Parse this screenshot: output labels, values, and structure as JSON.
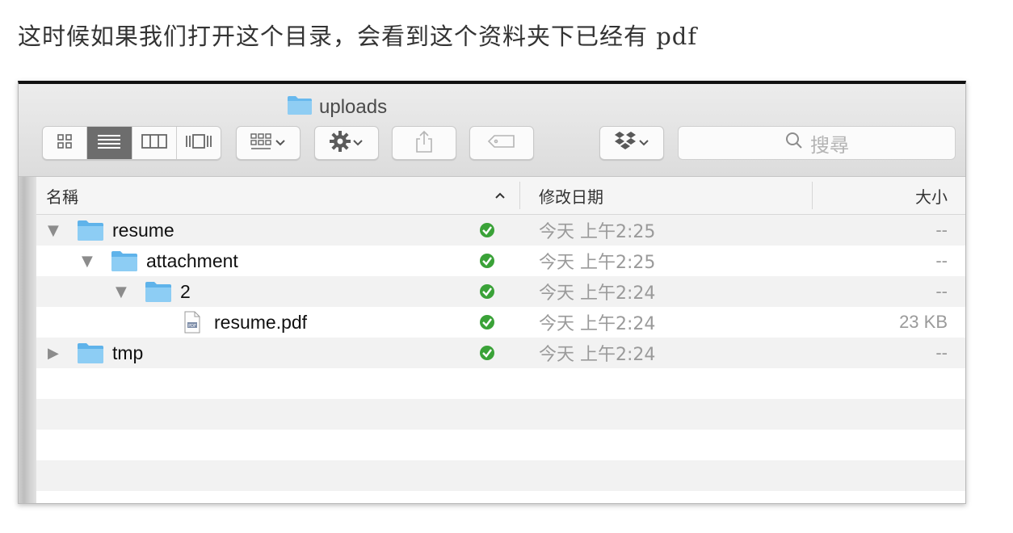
{
  "caption": "这时候如果我们打开这个目录，会看到这个资料夹下已经有 pdf",
  "window": {
    "title": "uploads",
    "search_placeholder": "搜尋"
  },
  "columns": {
    "name": "名稱",
    "sort_indicator": "^",
    "modified": "修改日期",
    "size": "大小"
  },
  "rows": [
    {
      "name": "resume",
      "type": "folder",
      "indent": 0,
      "disclosure": "▼",
      "date": "今天 上午2:25",
      "size": "--",
      "synced": true
    },
    {
      "name": "attachment",
      "type": "folder",
      "indent": 1,
      "disclosure": "▼",
      "date": "今天 上午2:25",
      "size": "--",
      "synced": true
    },
    {
      "name": "2",
      "type": "folder",
      "indent": 2,
      "disclosure": "▼",
      "date": "今天 上午2:24",
      "size": "--",
      "synced": true
    },
    {
      "name": "resume.pdf",
      "type": "pdf-file",
      "indent": 3,
      "disclosure": "",
      "date": "今天 上午2:24",
      "size": "23 KB",
      "synced": true
    },
    {
      "name": "tmp",
      "type": "folder",
      "indent": 0,
      "disclosure": "▶",
      "date": "今天 上午2:24",
      "size": "--",
      "synced": true
    }
  ],
  "icons": {
    "title_folder": "folder-icon",
    "view_icons": "icon-view-icon",
    "view_list": "list-view-icon",
    "view_columns": "column-view-icon",
    "view_coverflow": "cover-flow-icon",
    "arrange": "arrange-icon",
    "action": "gear-icon",
    "share": "share-icon",
    "tags": "tag-icon",
    "dropbox": "dropbox-icon",
    "search": "search-icon",
    "sync_status": "sync-check-icon"
  },
  "colors": {
    "folder": "#68b9ee",
    "sync_ok": "#3aa238",
    "active_segment": "#6d6d6d"
  }
}
